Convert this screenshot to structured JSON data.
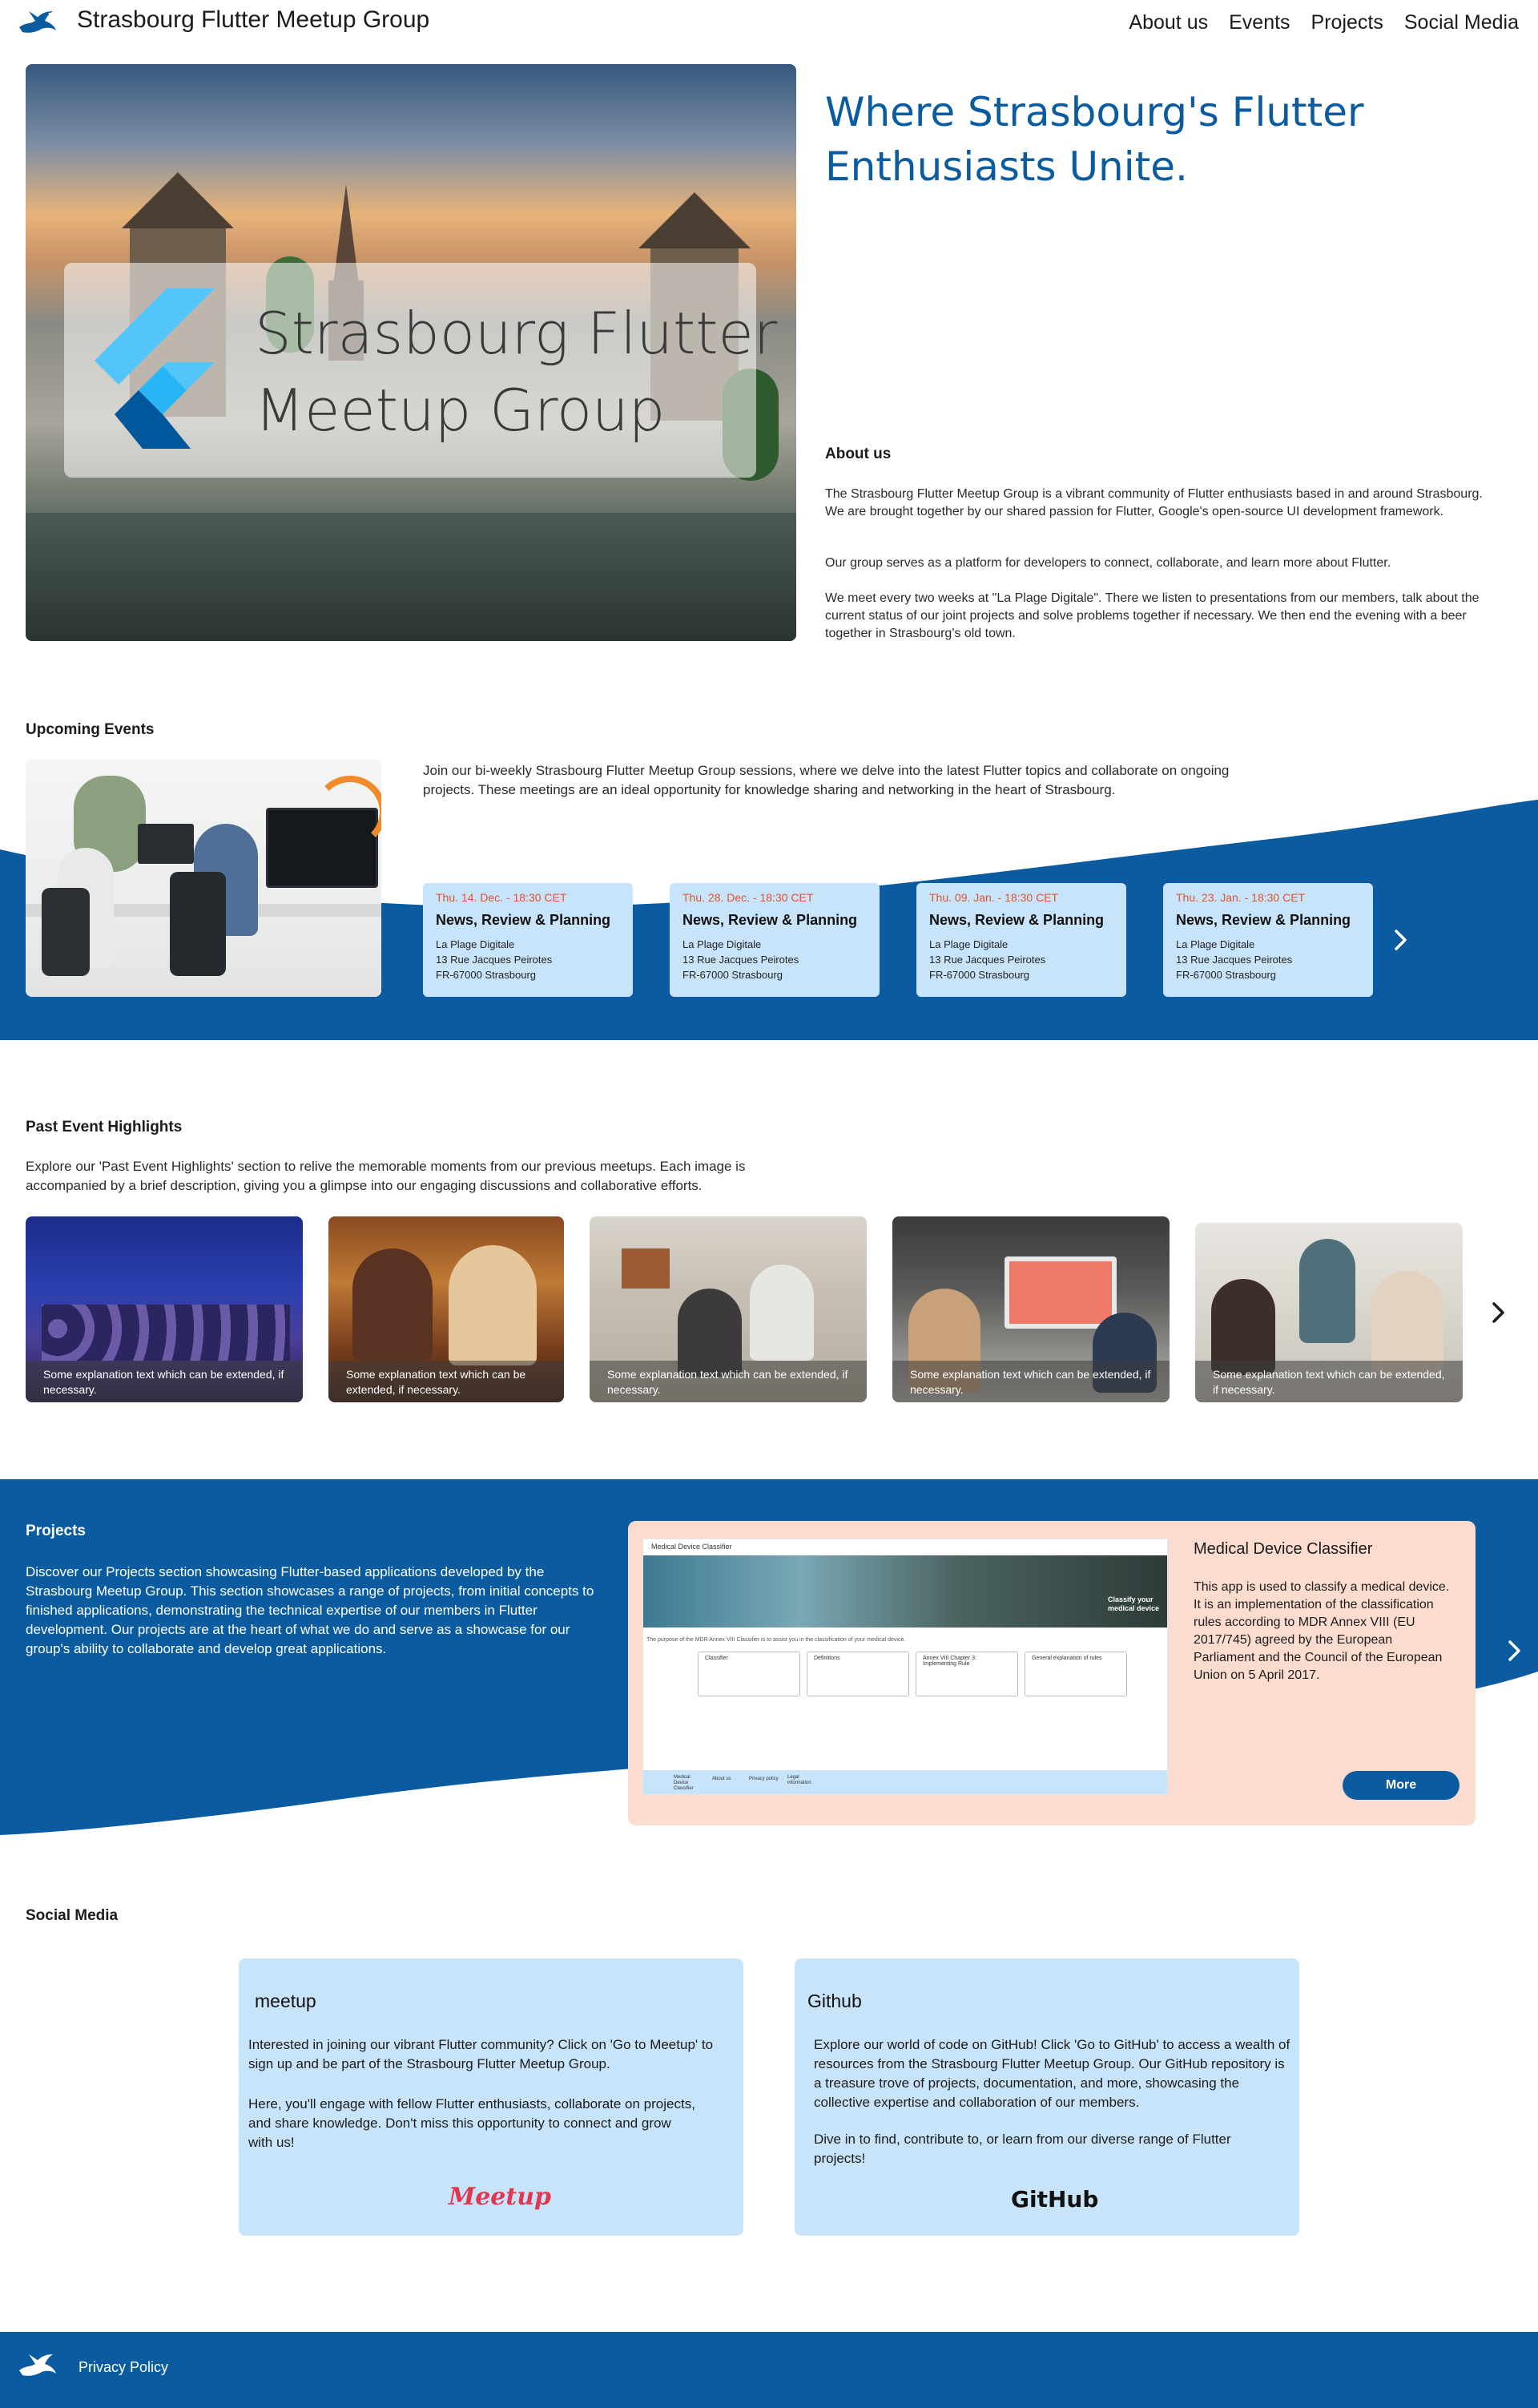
{
  "header": {
    "title": "Strasbourg Flutter Meetup Group",
    "nav": [
      "About us",
      "Events",
      "Projects",
      "Social Media"
    ]
  },
  "hero": {
    "brand_line1": "Strasbourg Flutter",
    "brand_line2": "Meetup Group",
    "tagline_line1": "Where Strasbourg's Flutter",
    "tagline_line2": "Enthusiasts Unite."
  },
  "about": {
    "heading": "About us",
    "p1": "The Strasbourg Flutter Meetup Group is a vibrant community of Flutter enthusiasts based in and around Strasbourg. We are brought together by our shared passion for Flutter, Google's open-source UI development framework.",
    "p2": "Our group serves as a platform for developers to connect, collaborate, and learn more about Flutter.",
    "p3": "We meet every two weeks at \"La Plage Digitale\". There we listen to presentations from our members, talk about  the current status of our joint projects and solve problems together if necessary. We then end the evening with a beer together in Strasbourg's old town."
  },
  "events": {
    "heading": "Upcoming Events",
    "intro": "Join our bi-weekly Strasbourg Flutter Meetup Group sessions, where we delve into the latest Flutter topics and collaborate on ongoing projects. These meetings are an ideal opportunity for knowledge sharing and networking in the heart of Strasbourg.",
    "items": [
      {
        "date": "Thu. 14. Dec. - 18:30 CET",
        "title": "News, Review & Planning",
        "venue": "La Plage Digitale",
        "street": "13 Rue Jacques Peirotes",
        "city": "FR-67000 Strasbourg"
      },
      {
        "date": "Thu. 28. Dec. - 18:30 CET",
        "title": "News, Review & Planning",
        "venue": "La Plage Digitale",
        "street": "13 Rue Jacques Peirotes",
        "city": "FR-67000 Strasbourg"
      },
      {
        "date": "Thu. 09. Jan. - 18:30 CET",
        "title": "News, Review & Planning",
        "venue": "La Plage Digitale",
        "street": "13 Rue Jacques Peirotes",
        "city": "FR-67000 Strasbourg"
      },
      {
        "date": "Thu. 23. Jan. - 18:30 CET",
        "title": "News, Review & Planning",
        "venue": "La Plage Digitale",
        "street": "13 Rue Jacques Peirotes",
        "city": "FR-67000 Strasbourg"
      }
    ]
  },
  "past": {
    "heading": "Past Event Highlights",
    "intro": "Explore our 'Past Event Highlights' section to relive the memorable moments from our previous meetups. Each image is accompanied by a brief description, giving you a glimpse into our engaging discussions and collaborative efforts.",
    "captions": [
      "Some explanation text which can be extended, if necessary.",
      "Some explanation text which can be extended, if necessary.",
      "Some explanation text which can be extended, if necessary.",
      "Some explanation text which can be extended, if necessary.",
      "Some explanation text which can be extended, if necessary."
    ]
  },
  "projects": {
    "heading": "Projects",
    "intro": "Discover our Projects section showcasing Flutter-based applications developed by the Strasbourg Meetup Group. This section showcases a range of projects, from initial concepts to finished applications, demonstrating the technical expertise of our members in Flutter development. Our projects are at the heart of what we do and serve as a showcase for our group's ability to collaborate and develop great applications.",
    "card": {
      "title": "Medical Device Classifier",
      "description": "This app is used to classify a medical device. It is an implementation of the classification rules according to MDR Annex VIII (EU 2017/745) agreed by the European Parliament and the Council of the European Union on 5 April 2017.",
      "more_label": "More",
      "screenshot": {
        "app_title": "Medical Device Classifier",
        "banner_line1": "Classify your",
        "banner_line2": "medical device",
        "purpose": "The purpose of the MDR Annex VIII Classifier is to assist you in the classification of your medical device.",
        "tiles": [
          "Classifier",
          "Definitions",
          "Annex VIII Chapter 3: Implementing Rule",
          "General explanation of rules"
        ],
        "footer_items": [
          "Medical Device Classifier",
          "About us",
          "Privacy policy",
          "Legal information"
        ]
      }
    }
  },
  "social": {
    "heading": "Social Media",
    "meetup": {
      "title": "meetup",
      "p1": "Interested in joining our vibrant Flutter community? Click on 'Go to Meetup' to sign up and be part of the Strasbourg Flutter Meetup Group.",
      "p2": "Here, you'll engage with fellow Flutter enthusiasts, collaborate on projects, and share knowledge. Don't miss this opportunity to connect and grow with us!",
      "logo_text": "Meetup"
    },
    "github": {
      "title": "Github",
      "p1": "Explore our world of code on GitHub! Click 'Go to GitHub' to access a wealth of resources from the Strasbourg Flutter Meetup Group. Our GitHub repository is a treasure trove of projects, documentation, and more, showcasing the collective expertise and collaboration of our members.",
      "p2": "Dive in to find, contribute to, or learn from our diverse range of Flutter projects!",
      "logo_text": "GitHub"
    }
  },
  "footer": {
    "privacy": "Privacy Policy"
  },
  "colors": {
    "primary_blue": "#0a5ba0",
    "card_light_blue": "#c8e4fb",
    "project_card_peach": "#fddcd0",
    "event_date_orange": "#e0542a"
  },
  "icons": [
    "stork-logo-icon",
    "flutter-logo-icon",
    "chevron-right-icon"
  ]
}
